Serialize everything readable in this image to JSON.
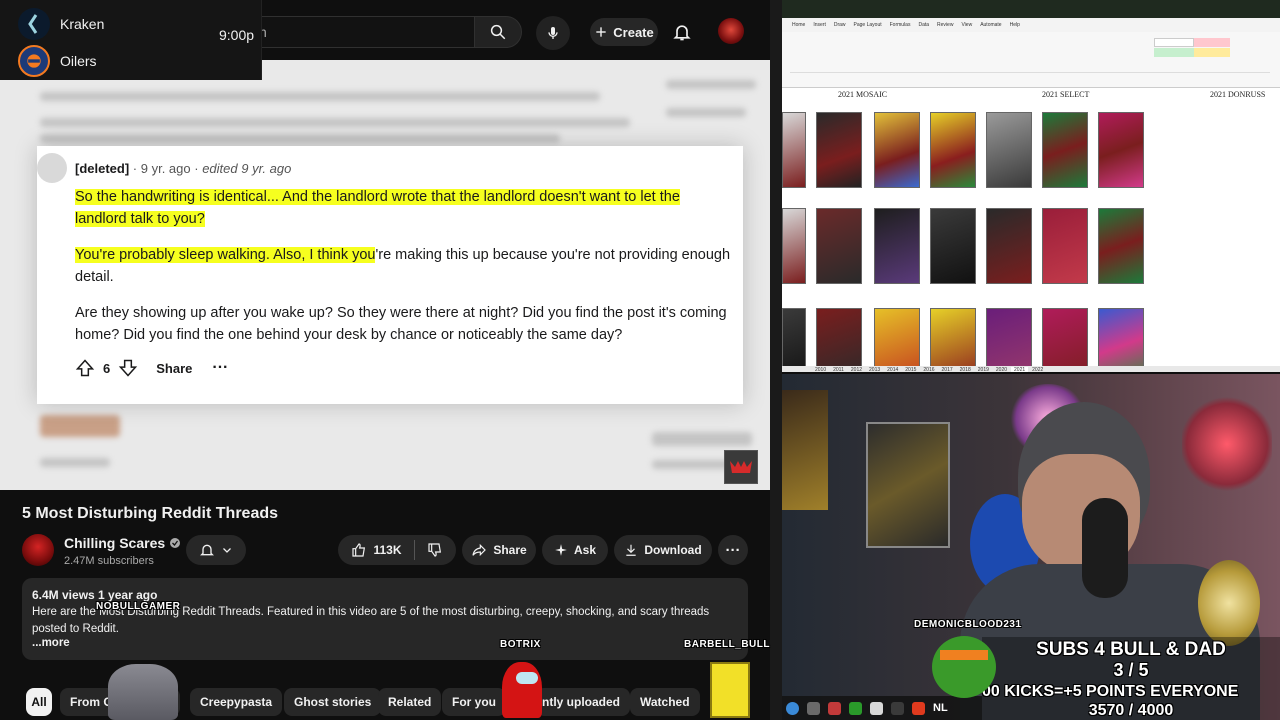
{
  "scoreboard": {
    "team1": "Kraken",
    "team2": "Oilers",
    "time": "9:00p"
  },
  "search": {
    "partial_text": "h"
  },
  "header": {
    "create_label": "Create"
  },
  "comment": {
    "author": "[deleted]",
    "age": "9 yr. ago",
    "edited": "edited 9 yr. ago",
    "p1": "So the handwriting is identical... And the landlord wrote that the landlord doesn't want to let the landlord talk to you?",
    "p2_highlight": "You're probably sleep walking. Also, I think you",
    "p2_rest": "'re making this up because you're not providing enough detail.",
    "p3": "Are they showing up after you wake up? So they were there at night? Did you find the post it's coming home? Did you find the one behind your desk by chance or noticeably the same day?",
    "votes": "6",
    "share": "Share",
    "more": "···"
  },
  "video": {
    "title": "5 Most Disturbing Reddit Threads",
    "channel": "Chilling Scares",
    "subscribers": "2.47M subscribers",
    "likes": "113K",
    "share": "Share",
    "ask": "Ask",
    "download": "Download",
    "more": "···",
    "views": "6.4M views  1 year ago",
    "description": "Here are the Most Disturbing Reddit Threads. Featured in this video are 5 of the most disturbing, creepy, shocking, and scary threads posted to Reddit.",
    "show_more": "...more"
  },
  "chips": [
    "All",
    "From C",
    "Creepypasta",
    "Ghost stories",
    "Related",
    "For you",
    "ntly uploaded",
    "Watched"
  ],
  "overlay_names": [
    "NOBULLGAMER",
    "BOTRIX",
    "BARBELL_BULL",
    "DEMONICBLOOD231"
  ],
  "excel": {
    "menu": [
      "Home",
      "Insert",
      "Draw",
      "Page Layout",
      "Formulas",
      "Data",
      "Review",
      "View",
      "Automate",
      "Help"
    ],
    "headers": [
      "2021 MOSAIC",
      "2021 SELECT",
      "2021 DONRUSS"
    ],
    "tabs": [
      "2010",
      "2011",
      "2012",
      "2013",
      "2014",
      "2015",
      "2016",
      "2017",
      "2018",
      "2019",
      "2020",
      "2021",
      "2022"
    ]
  },
  "stream": {
    "goal1_title": "SUBS 4 BULL & DAD",
    "goal1_progress": "3 / 5",
    "goal2_title": "00 KICKS=+5 POINTS EVERYONE",
    "goal2_progress": "3570 / 4000",
    "taskbar_text": "NL"
  },
  "colors": {
    "highlight": "#f6ff1f",
    "yt_bg": "#0f0f0f",
    "pill": "#272727"
  }
}
